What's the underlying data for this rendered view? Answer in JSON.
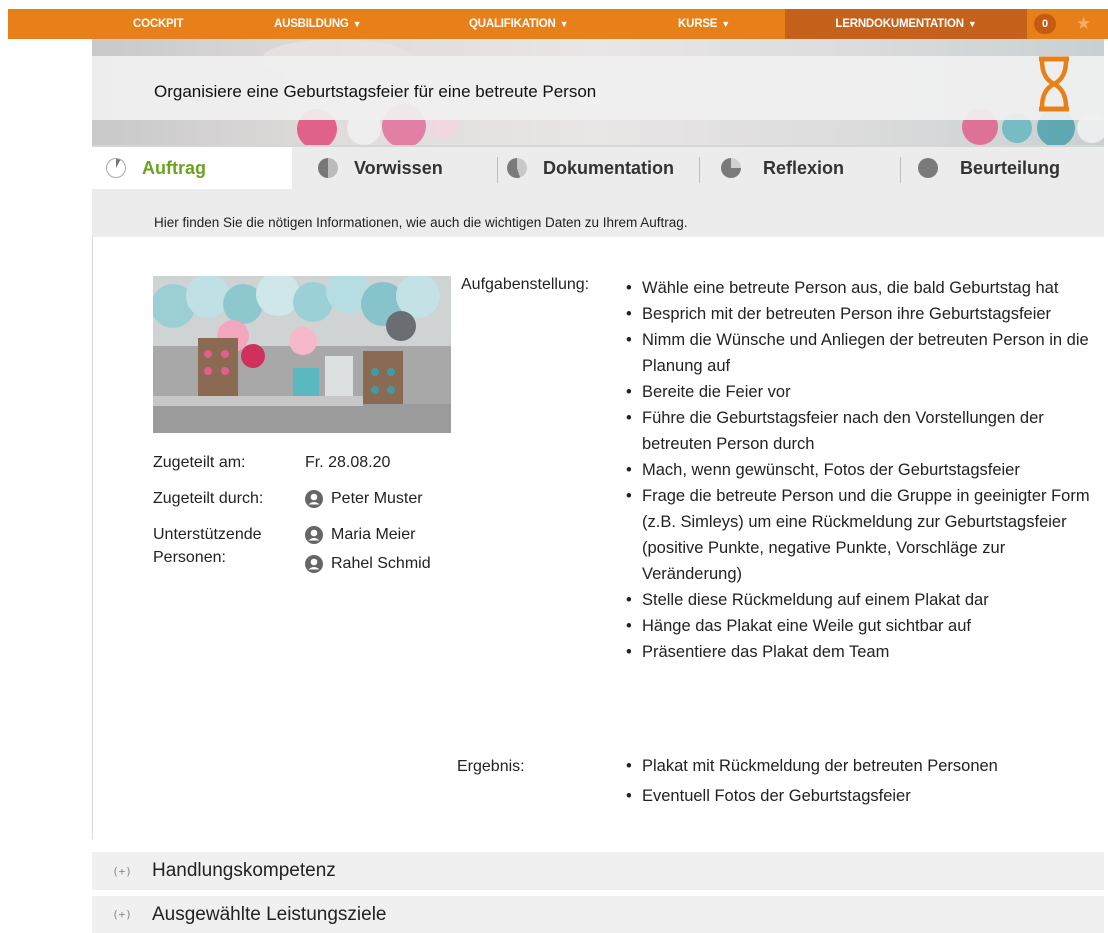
{
  "nav": {
    "items": [
      {
        "label": "COCKPIT",
        "caret": ""
      },
      {
        "label": "AUSBILDUNG",
        "caret": "▼"
      },
      {
        "label": "QUALIFIKATION",
        "caret": "▼"
      },
      {
        "label": "KURSE",
        "caret": "▼"
      },
      {
        "label": "LERNDOKUMENTATION",
        "caret": "▼"
      }
    ],
    "badge_count": "0",
    "star_icon": "star-icon",
    "accent_color": "#e8801a",
    "active_color": "#c5611b"
  },
  "banner": {
    "title": "Organisiere eine Geburtstagsfeier für eine betreute Person",
    "status_icon": "hourglass-icon"
  },
  "tabs": [
    {
      "label": "Auftrag",
      "active": true,
      "icon": "pie-icon"
    },
    {
      "label": "Vorwissen",
      "active": false,
      "icon": "pie-icon"
    },
    {
      "label": "Dokumentation",
      "active": false,
      "icon": "pie-icon"
    },
    {
      "label": "Reflexion",
      "active": false,
      "icon": "pie-icon"
    },
    {
      "label": "Beurteilung",
      "active": false,
      "icon": "pie-icon"
    }
  ],
  "info": "Hier finden Sie die nötigen Informationen, wie auch die wichtigen Daten zu Ihrem Auftrag.",
  "meta": {
    "assigned_on_label": "Zugeteilt am:",
    "assigned_on_value": "Fr. 28.08.20",
    "assigned_by_label": "Zugeteilt durch:",
    "assigned_by_value": "Peter Muster",
    "supporters_label_1": "Unterstützende",
    "supporters_label_2": "Personen:",
    "supporters": [
      "Maria Meier",
      "Rahel Schmid"
    ]
  },
  "task": {
    "label": "Aufgabenstellung:",
    "items": [
      "Wähle eine betreute Person aus, die bald Geburtstag hat",
      "Besprich mit der betreuten Person ihre Geburtstagsfeier",
      "Nimm die Wünsche und Anliegen der betreuten Person in die Planung auf",
      "Bereite die Feier vor",
      "Führe die Geburtstagsfeier nach den Vorstellungen der betreuten Person durch",
      "Mach, wenn gewünscht, Fotos der Geburtstagsfeier",
      "Frage die betreute Person und die Gruppe in geeinigter Form (z.B. Simleys) um eine Rückmeldung zur Geburtstagsfeier (positive Punkte, negative Punkte, Vorschläge zur Veränderung)",
      "Stelle diese Rückmeldung auf einem Plakat dar",
      "Hänge das Plakat eine Weile gut sichtbar auf",
      "Präsentiere das Plakat dem Team"
    ]
  },
  "result": {
    "label": "Ergebnis:",
    "items": [
      "Plakat mit Rückmeldung der betreuten Personen",
      "Eventuell Fotos der Geburtstagsfeier"
    ]
  },
  "accordion": [
    {
      "label": "Handlungskompetenz",
      "toggle": "(+)"
    },
    {
      "label": "Ausgewählte Leistungsziele",
      "toggle": "(+)"
    }
  ]
}
